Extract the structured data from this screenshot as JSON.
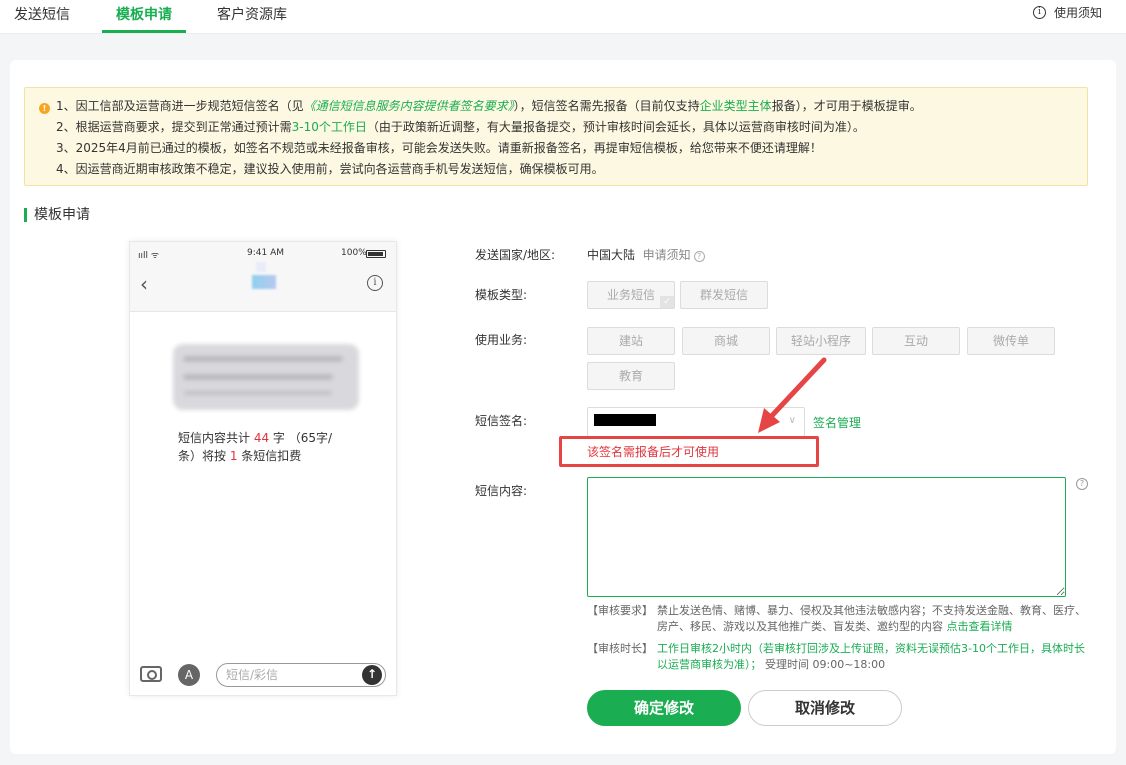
{
  "nav": {
    "tabs": [
      {
        "label": "发送短信"
      },
      {
        "label": "模板申请"
      },
      {
        "label": "客户资源库"
      }
    ],
    "help_label": "使用须知"
  },
  "notice": {
    "line1_a": "1、因工信部及运营商进一步规范短信签名（见",
    "line1_link": "《通信短信息服务内容提供者签名要求》",
    "line1_b": "），短信签名需先报备（目前仅支持",
    "line1_link2": "企业类型主体",
    "line1_c": "报备），才可用于模板提审。",
    "line2_a": "2、根据运营商要求，提交到正常通过预计需",
    "line2_hl": "3-10个工作日",
    "line2_b": "（由于政策新近调整，有大量报备提交，预计审核时间会延长，具体以运营商审核时间为准）。",
    "line3": "3、2025年4月前已通过的模板，如签名不规范或未经报备审核，可能会发送失败。请重新报备签名，再提审短信模板，给您带来不便还请理解！",
    "line4": "4、因运营商近期审核政策不稳定，建议投入使用前，尝试向各运营商手机号发送短信，确保模板可用。"
  },
  "section_title": "模板申请",
  "phone": {
    "signal": "ııll ᯤ",
    "time": "9:41 AM",
    "battery": "100%",
    "count_a": "短信内容共计 ",
    "count_num": "44",
    "count_b": " 字 （65字/",
    "count_c": "条）将按 ",
    "count_sms": "1",
    "count_d": " 条短信扣费",
    "input_placeholder": "短信/彩信"
  },
  "form": {
    "country_label": "发送国家/地区:",
    "country_value": "中国大陆",
    "apply_notice": "申请须知",
    "type_label": "模板类型:",
    "types": [
      "业务短信",
      "群发短信"
    ],
    "biz_label": "使用业务:",
    "biz_options": [
      "建站",
      "商城",
      "轻站小程序",
      "互动",
      "微传单",
      "教育"
    ],
    "sig_label": "短信签名:",
    "sig_manage": "签名管理",
    "sig_warning": "该签名需报备后才可使用",
    "content_label": "短信内容:",
    "rule1_tag": "【审核要求】",
    "rule1_body": "禁止发送色情、赌博、暴力、侵权及其他违法敏感内容；不支持发送金融、教育、医疗、房产、移民、游戏以及其他推广类、盲发类、邀约型的内容",
    "rule1_link": "点击查看详情",
    "rule2_tag": "【审核时长】",
    "rule2_body": "工作日审核2小时内（若审核打回涉及上传证照，资料无误预估3-10个工作日，具体时长以运营商审核为准）；",
    "rule2_tail": "受理时间 09:00~18:00",
    "confirm": "确定修改",
    "cancel": "取消修改"
  },
  "colors": {
    "brand": "#1aad52",
    "warning": "#e0343d",
    "annotation": "#e64545"
  }
}
